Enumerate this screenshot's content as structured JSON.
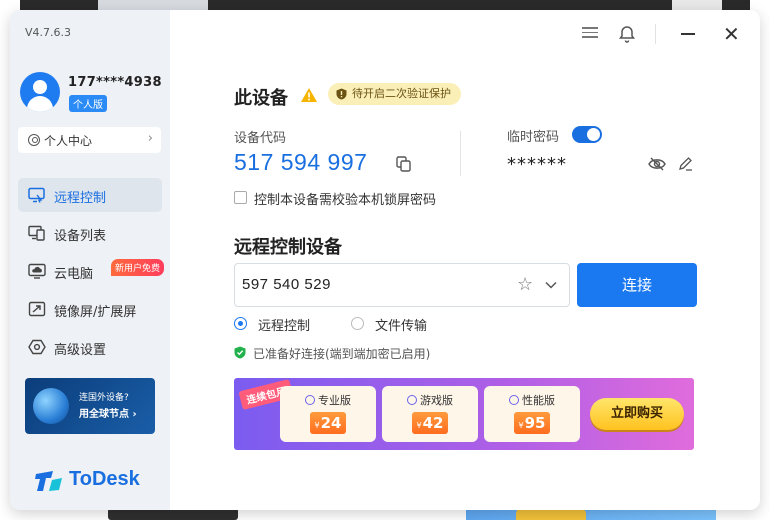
{
  "app": {
    "version": "V4.7.6.3",
    "brand": "ToDesk",
    "accent_color": "#1a6fe0"
  },
  "user": {
    "phone": "177****4938",
    "plan": "个人版",
    "personal_center": "个人中心"
  },
  "sidebar": {
    "items": [
      {
        "label": "远程控制",
        "icon": "remote-control-icon",
        "active": true
      },
      {
        "label": "设备列表",
        "icon": "device-list-icon",
        "active": false
      },
      {
        "label": "云电脑",
        "icon": "cloud-pc-icon",
        "active": false,
        "badge": "新用户免费"
      },
      {
        "label": "镜像屏/扩展屏",
        "icon": "mirror-screen-icon",
        "active": false
      },
      {
        "label": "高级设置",
        "icon": "settings-icon",
        "active": false
      }
    ],
    "promo": {
      "line1": "连国外设备?",
      "line2": "用全球节点"
    }
  },
  "device": {
    "title": "此设备",
    "security_prompt": "待开启二次验证保护",
    "code_label": "设备代码",
    "code": "517 594 997",
    "temp_password_label": "临时密码",
    "temp_password_enabled": true,
    "temp_password": "******",
    "lock_check_label": "控制本设备需校验本机锁屏密码",
    "lock_check_checked": false
  },
  "remote": {
    "title": "远程控制设备",
    "device_id": "597 540 529",
    "connect_button": "连接",
    "modes": [
      {
        "label": "远程控制",
        "selected": true
      },
      {
        "label": "文件传输",
        "selected": false
      }
    ],
    "status": "已准备好连接(端到端加密已启用)"
  },
  "banner": {
    "tag": "连续包月",
    "plans": [
      {
        "name": "专业版",
        "price": "24"
      },
      {
        "name": "游戏版",
        "price": "42"
      },
      {
        "name": "性能版",
        "price": "95"
      }
    ],
    "currency": "¥",
    "buy_button": "立即购买"
  }
}
